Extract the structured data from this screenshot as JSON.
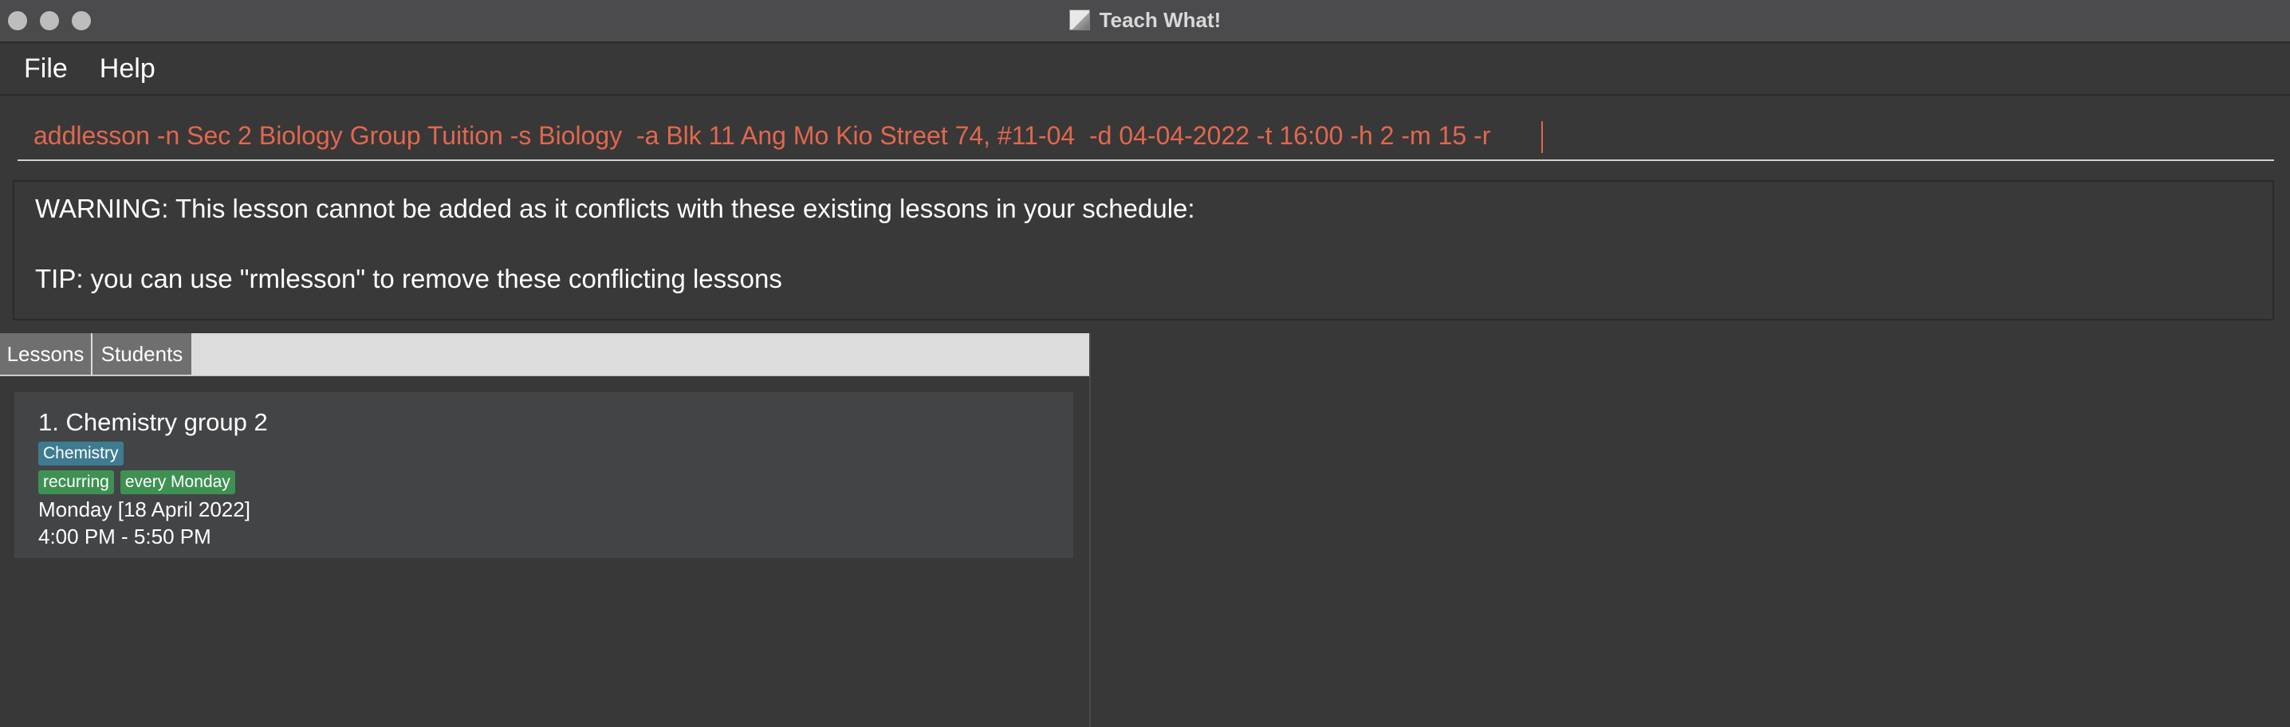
{
  "window": {
    "title": "Teach What!"
  },
  "menu": {
    "file": "File",
    "help": "Help"
  },
  "command": {
    "value": "addlesson -n Sec 2 Biology Group Tuition -s Biology  -a Blk 11 Ang Mo Kio Street 74, #11-04  -d 04-04-2022 -t 16:00 -h 2 -m 15 -r"
  },
  "result": {
    "warning": "WARNING: This lesson cannot be added as it conflicts with these existing lessons in your schedule:",
    "tip": "TIP: you can use \"rmlesson\" to remove these conflicting lessons"
  },
  "tabs": {
    "lessons": "Lessons",
    "students": "Students"
  },
  "lessons": [
    {
      "title": "1.  Chemistry group 2",
      "subject": "Chemistry",
      "tags": [
        "recurring",
        "every Monday"
      ],
      "date": "Monday [18 April 2022]",
      "time": "4:00 PM - 5:50 PM"
    }
  ],
  "colors": {
    "command_text": "#e2674e",
    "subject_tag": "#3e7b91",
    "recurring_tag": "#3e9152",
    "background": "#383838"
  }
}
